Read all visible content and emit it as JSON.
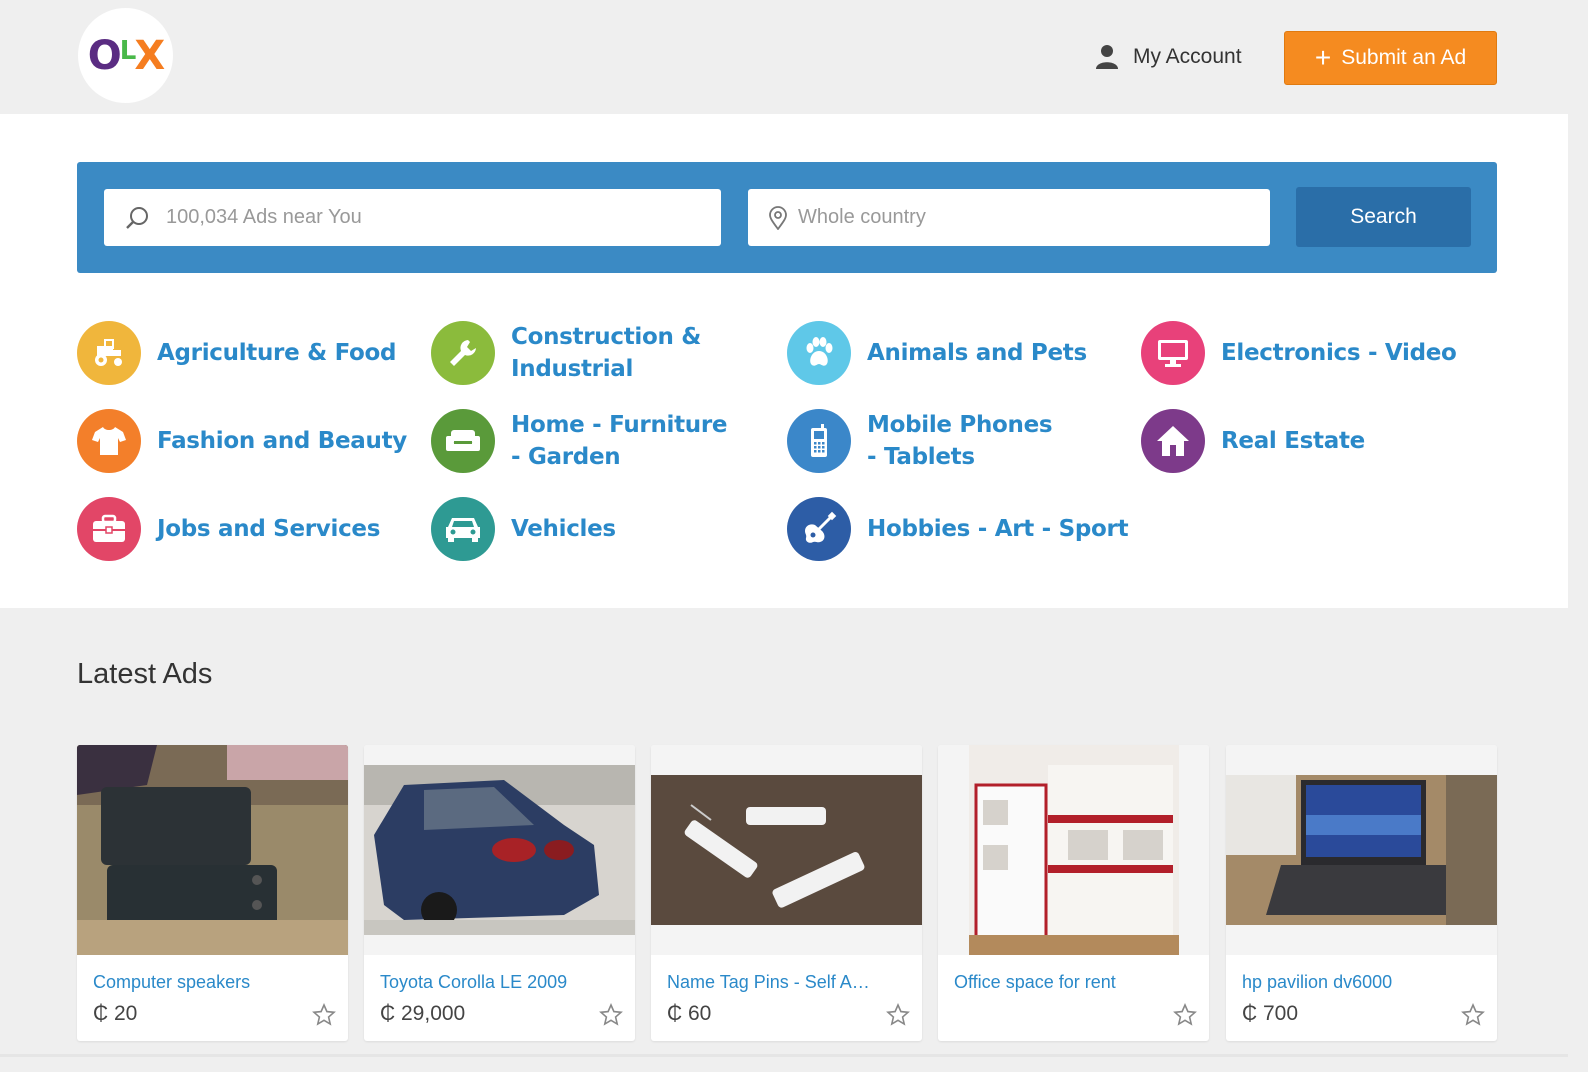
{
  "header": {
    "logo_letters": [
      "O",
      "L",
      "X"
    ],
    "account_label": "My Account",
    "submit_label": "Submit an Ad",
    "submit_color": "#f58b20"
  },
  "search": {
    "query_placeholder": "100,034 Ads near You",
    "location_placeholder": "Whole country",
    "button_label": "Search",
    "bar_color": "#3b8ac4"
  },
  "categories": [
    {
      "label": "Agriculture & Food",
      "icon": "tractor-icon",
      "color": "#f0b63c"
    },
    {
      "label": "Construction & Industrial",
      "icon": "wrench-icon",
      "color": "#8bbb3c"
    },
    {
      "label": "Animals and Pets",
      "icon": "paw-icon",
      "color": "#5fc8e8"
    },
    {
      "label": "Electronics - Video",
      "icon": "monitor-icon",
      "color": "#e8417a"
    },
    {
      "label": "Fashion and Beauty",
      "icon": "tshirt-icon",
      "color": "#f37f2a"
    },
    {
      "label": "Home - Furniture - Garden",
      "icon": "sofa-icon",
      "color": "#5a9a3a"
    },
    {
      "label": "Mobile Phones - Tablets",
      "icon": "mobile-phone-icon",
      "color": "#3b87c9"
    },
    {
      "label": "Real Estate",
      "icon": "house-icon",
      "color": "#7d3a8a"
    },
    {
      "label": "Jobs and Services",
      "icon": "briefcase-icon",
      "color": "#e24667"
    },
    {
      "label": "Vehicles",
      "icon": "car-icon",
      "color": "#2e9a93"
    },
    {
      "label": "Hobbies - Art - Sport",
      "icon": "guitar-icon",
      "color": "#2d5da6"
    }
  ],
  "latest": {
    "title": "Latest Ads",
    "ads": [
      {
        "title": "Computer speakers",
        "price": "₵ 20"
      },
      {
        "title": "Toyota Corolla LE 2009",
        "price": "₵ 29,000"
      },
      {
        "title": "Name Tag Pins - Self Adhesive",
        "price": "₵ 60"
      },
      {
        "title": "Office space for rent",
        "price": ""
      },
      {
        "title": "hp pavilion dv6000",
        "price": "₵ 700"
      }
    ]
  }
}
